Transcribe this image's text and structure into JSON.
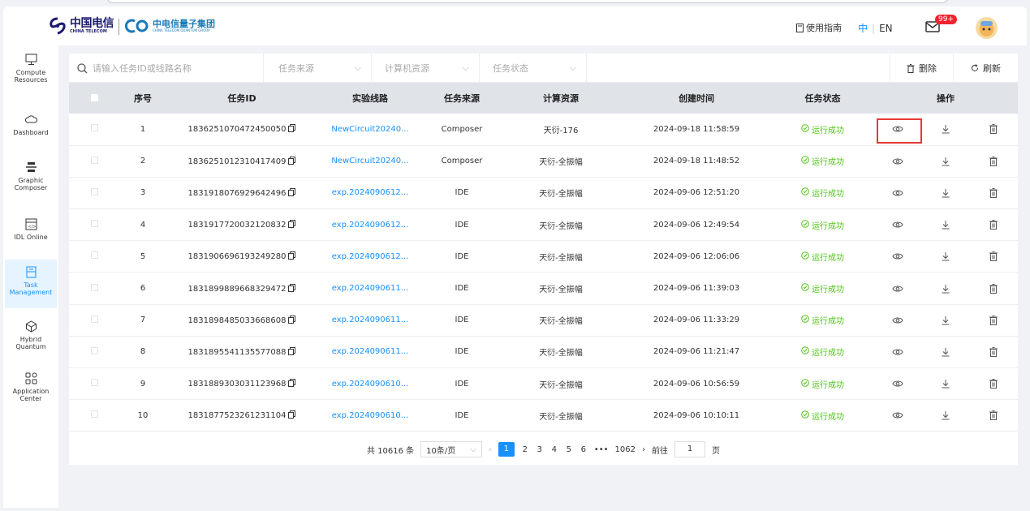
{
  "brand": {
    "telecom_name": "中国电信",
    "telecom_en": "CHINA TELECOM",
    "quantum_name": "中电信量子集团",
    "quantum_en": "CHINA TELECOM QUANTUM GROUP"
  },
  "header": {
    "guide": "使用指南",
    "lang_zh": "中",
    "lang_en": "EN",
    "badge": "99+"
  },
  "sidebar": {
    "items": [
      {
        "label": "Compute Resources",
        "icon": "monitor-icon"
      },
      {
        "label": "Dashboard",
        "icon": "cloud-icon"
      },
      {
        "label": "Graphic Composer",
        "icon": "stack-icon"
      },
      {
        "label": "IDL Online",
        "icon": "code-window-icon"
      },
      {
        "label": "Task Management",
        "icon": "clipboard-icon",
        "active": true
      },
      {
        "label": "Hybrid Quantum",
        "icon": "cube-icon"
      },
      {
        "label": "Application Center",
        "icon": "grid-icon"
      }
    ]
  },
  "filters": {
    "search_placeholder": "请输入任务ID或线路名称",
    "source_placeholder": "任务来源",
    "compute_placeholder": "计算机资源",
    "status_placeholder": "任务状态",
    "delete_label": "删除",
    "refresh_label": "刷新"
  },
  "table": {
    "headers": [
      "序号",
      "任务ID",
      "实验线路",
      "任务来源",
      "计算资源",
      "创建时间",
      "任务状态",
      "操作"
    ],
    "rows": [
      {
        "idx": "1",
        "id": "1836251070472450050",
        "circuit": "NewCircuit20240...",
        "source": "Composer",
        "resource": "天衍-176",
        "time": "2024-09-18 11:58:59",
        "status": "运行成功"
      },
      {
        "idx": "2",
        "id": "1836251012310417409",
        "circuit": "NewCircuit20240...",
        "source": "Composer",
        "resource": "天衍-全振幅",
        "time": "2024-09-18 11:48:52",
        "status": "运行成功"
      },
      {
        "idx": "3",
        "id": "1831918076929642496",
        "circuit": "exp.2024090612...",
        "source": "IDE",
        "resource": "天衍-全振幅",
        "time": "2024-09-06 12:51:20",
        "status": "运行成功"
      },
      {
        "idx": "4",
        "id": "1831917720032120832",
        "circuit": "exp.2024090612...",
        "source": "IDE",
        "resource": "天衍-全振幅",
        "time": "2024-09-06 12:49:54",
        "status": "运行成功"
      },
      {
        "idx": "5",
        "id": "1831906696193249280",
        "circuit": "exp.2024090612...",
        "source": "IDE",
        "resource": "天衍-全振幅",
        "time": "2024-09-06 12:06:06",
        "status": "运行成功"
      },
      {
        "idx": "6",
        "id": "1831899889668329472",
        "circuit": "exp.2024090611...",
        "source": "IDE",
        "resource": "天衍-全振幅",
        "time": "2024-09-06 11:39:03",
        "status": "运行成功"
      },
      {
        "idx": "7",
        "id": "1831898485033668608",
        "circuit": "exp.2024090611...",
        "source": "IDE",
        "resource": "天衍-全振幅",
        "time": "2024-09-06 11:33:29",
        "status": "运行成功"
      },
      {
        "idx": "8",
        "id": "1831895541135577088",
        "circuit": "exp.2024090611...",
        "source": "IDE",
        "resource": "天衍-全振幅",
        "time": "2024-09-06 11:21:47",
        "status": "运行成功"
      },
      {
        "idx": "9",
        "id": "1831889303031123968",
        "circuit": "exp.2024090610...",
        "source": "IDE",
        "resource": "天衍-全振幅",
        "time": "2024-09-06 10:56:59",
        "status": "运行成功"
      },
      {
        "idx": "10",
        "id": "1831877523261231104",
        "circuit": "exp.2024090610...",
        "source": "IDE",
        "resource": "天衍-全振幅",
        "time": "2024-09-06 10:10:11",
        "status": "运行成功"
      }
    ]
  },
  "pager": {
    "total": "共 10616 条",
    "page_size": "10条/页",
    "pages": [
      "1",
      "2",
      "3",
      "4",
      "5",
      "6",
      "•••",
      "1062"
    ],
    "current": "1",
    "goto_label": "前往",
    "goto_value": "1",
    "page_unit": "页"
  },
  "colors": {
    "accent": "#1890ff",
    "success": "#52c41a",
    "highlight": "#e53935"
  }
}
